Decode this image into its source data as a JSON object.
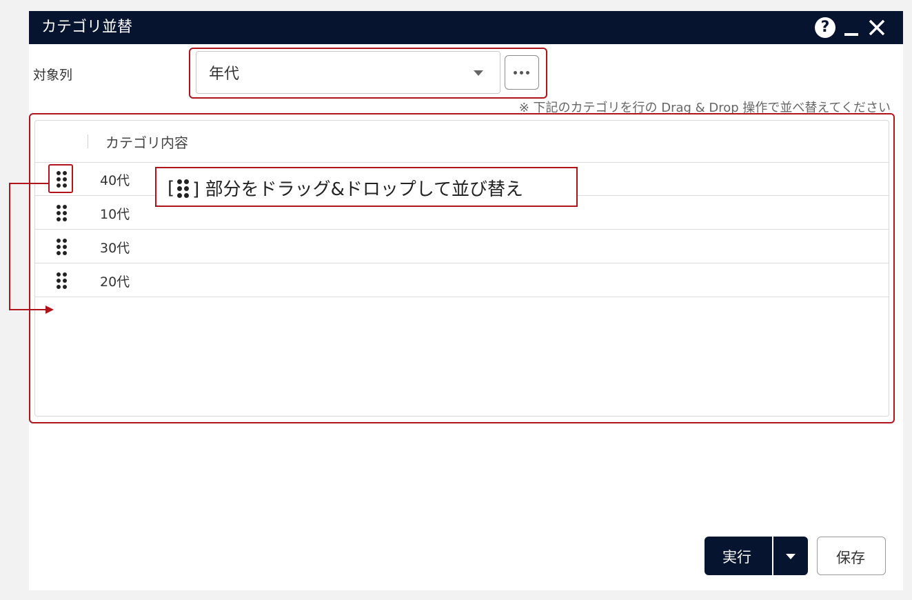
{
  "dialog": {
    "title": "カテゴリ並替",
    "help_symbol": "?",
    "target_label": "対象列",
    "select_value": "年代",
    "hint": "※ 下記のカテゴリを行の Drag & Drop 操作で並べ替えてください",
    "column_header": "カテゴリ内容",
    "rows": [
      "40代",
      "10代",
      "30代",
      "20代"
    ],
    "run_label": "実行",
    "save_label": "保存"
  },
  "annotation": {
    "text_prefix": "[",
    "text_suffix": "] 部分をドラッグ&ドロップして並び替え",
    "color": "#b0131a"
  },
  "colors": {
    "titlebar": "#06142f",
    "accent": "#b0131a"
  },
  "icons": {
    "help": "help-icon",
    "minimize": "minimize-icon",
    "close": "close-icon",
    "more": "more-icon",
    "drag": "drag-handle-icon"
  }
}
